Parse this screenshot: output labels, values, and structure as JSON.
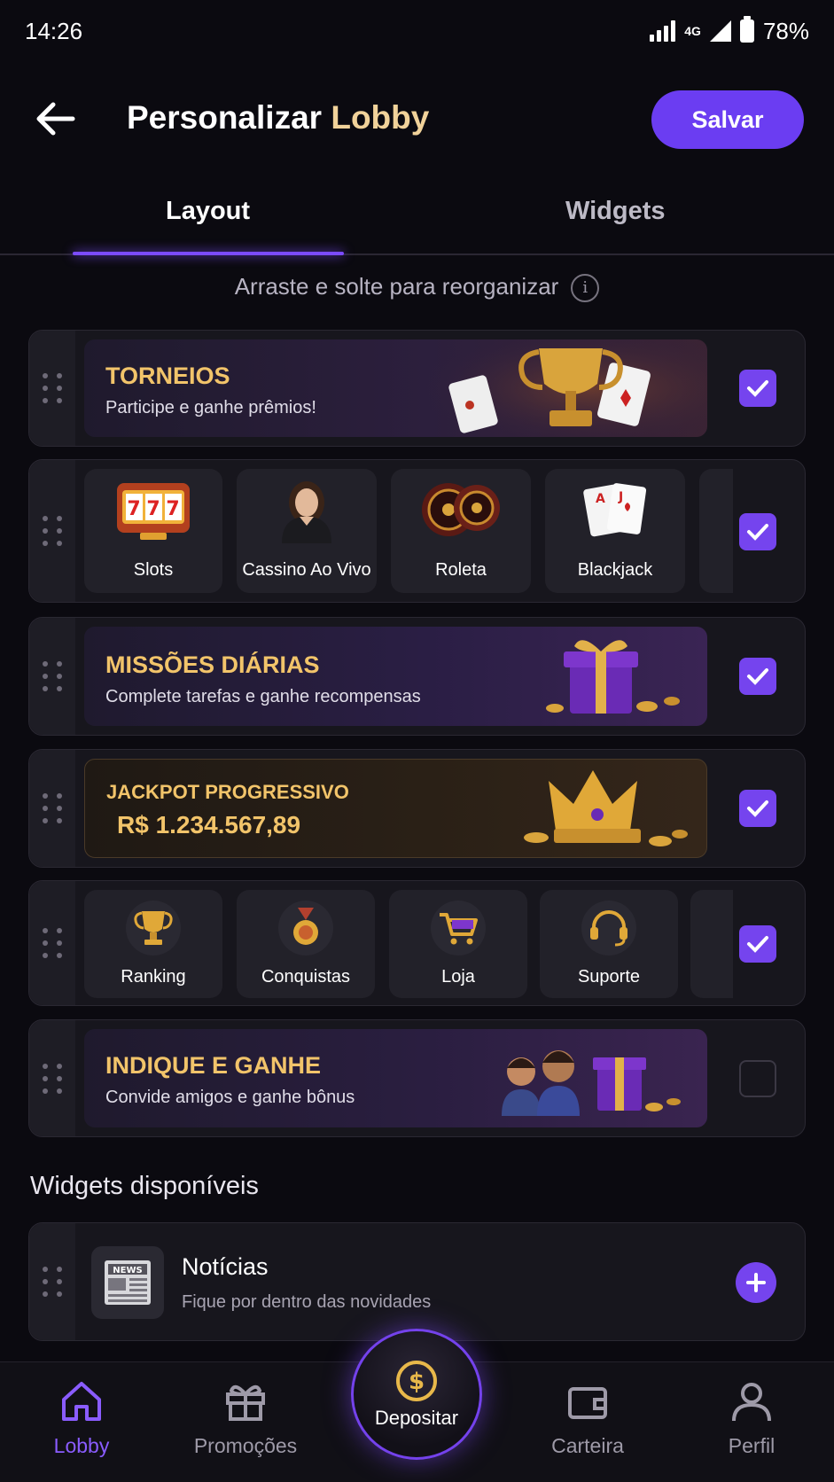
{
  "status_bar": {
    "time": "14:26",
    "network": "4G",
    "battery": "78%"
  },
  "header": {
    "title_main": "Personalizar",
    "title_accent": "Lobby",
    "save_label": "Salvar"
  },
  "tabs": [
    {
      "label": "Layout",
      "active": true
    },
    {
      "label": "Widgets",
      "active": false
    }
  ],
  "hint": "Arraste e solte para reorganizar",
  "layout_items": {
    "torneios": {
      "title": "TORNEIOS",
      "subtitle": "Participe e ganhe prêmios!",
      "checked": true
    },
    "games": {
      "checked": true,
      "tiles": [
        {
          "label": "Slots"
        },
        {
          "label": "Cassino Ao Vivo"
        },
        {
          "label": "Roleta"
        },
        {
          "label": "Blackjack"
        }
      ]
    },
    "missoes": {
      "title": "MISSÕES DIÁRIAS",
      "subtitle": "Complete tarefas e ganhe recompensas",
      "checked": true
    },
    "jackpot": {
      "title": "JACKPOT PROGRESSIVO",
      "value": "R$ 1.234.567,89",
      "checked": true
    },
    "shortcuts": {
      "checked": true,
      "tiles": [
        {
          "label": "Ranking"
        },
        {
          "label": "Conquistas"
        },
        {
          "label": "Loja"
        },
        {
          "label": "Suporte"
        }
      ]
    },
    "indique": {
      "title": "INDIQUE E GANHE",
      "subtitle": "Convide amigos e ganhe bônus",
      "checked": false
    }
  },
  "available_widgets": {
    "title": "Widgets disponíveis",
    "items": [
      {
        "title": "Notícias",
        "subtitle": "Fique por dentro das novidades",
        "icon_text": "NEWS"
      }
    ]
  },
  "bottom_nav": {
    "items": [
      {
        "label": "Lobby",
        "active": true
      },
      {
        "label": "Promoções"
      },
      {
        "label": "Carteira"
      },
      {
        "label": "Perfil"
      }
    ],
    "deposit_label": "Depositar"
  },
  "colors": {
    "accent": "#7544ee",
    "gold": "#f2c46a",
    "background": "#0b0a10"
  }
}
